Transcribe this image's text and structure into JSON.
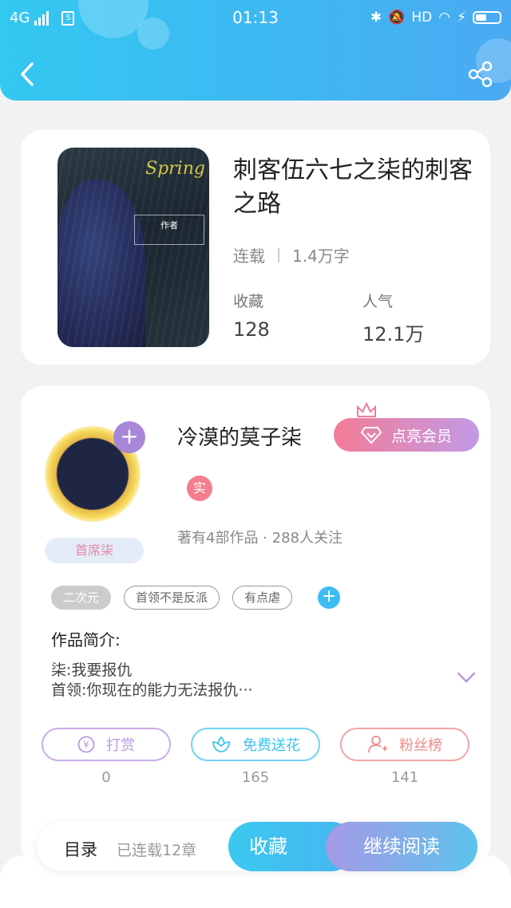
{
  "status_bar": {
    "network": "4G",
    "time": "01:13",
    "hd": "HD"
  },
  "book": {
    "title": "刺客伍六七之柒的刺客之路",
    "status": "连载",
    "word_count": "1.4万字",
    "favorites_label": "收藏",
    "favorites_value": "128",
    "popularity_label": "人气",
    "popularity_value": "12.1万",
    "cover": {
      "script_text": "Spring",
      "box_label": "作者"
    }
  },
  "author": {
    "name": "冷漠的莫子柒",
    "vip_label": "点亮会员",
    "real_badge": "实",
    "works_info": "著有4部作品 · 288人关注",
    "nameplate": "首席柒"
  },
  "tags": [
    "二次元",
    "首领不是反派",
    "有点虐"
  ],
  "intro": {
    "title": "作品简介:",
    "line1": "柒:我要报仇",
    "line2": "首领:你现在的能力无法报仇···"
  },
  "actions": [
    {
      "label": "打赏",
      "count": "0",
      "color": "#b89ae0"
    },
    {
      "label": "免费送花",
      "count": "165",
      "color": "#3cc4ec"
    },
    {
      "label": "粉丝榜",
      "count": "141",
      "color": "#f08a8a"
    }
  ],
  "bottom_bar": {
    "toc_label": "目录",
    "serial_count": "已连载12章",
    "favorite_label": "收藏",
    "continue_label": "继续阅读"
  }
}
